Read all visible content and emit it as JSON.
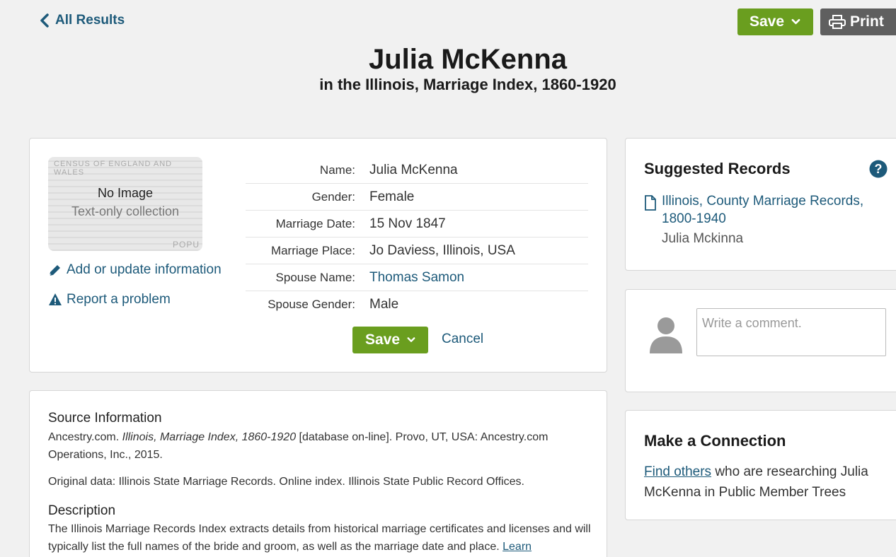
{
  "nav": {
    "back_label": "All Results"
  },
  "toolbar": {
    "save_label": "Save",
    "print_label": "Print"
  },
  "header": {
    "title": "Julia McKenna",
    "subtitle": "in the Illinois, Marriage Index, 1860-1920"
  },
  "record": {
    "image": {
      "ghost_top": "CENSUS OF ENGLAND AND WALES",
      "ghost_bottom": "POPU",
      "no_image": "No Image",
      "note": "Text-only collection"
    },
    "add_update_label": "Add or update information",
    "report_label": "Report a problem",
    "fields": [
      {
        "label": "Name:",
        "value": "Julia McKenna"
      },
      {
        "label": "Gender:",
        "value": "Female"
      },
      {
        "label": "Marriage Date:",
        "value": "15 Nov 1847"
      },
      {
        "label": "Marriage Place:",
        "value": "Jo Daviess, Illinois, USA"
      },
      {
        "label": "Spouse Name:",
        "value": "Thomas Samon"
      },
      {
        "label": "Spouse Gender:",
        "value": "Male"
      }
    ],
    "save_label": "Save",
    "cancel_label": "Cancel"
  },
  "source": {
    "heading": "Source Information",
    "citation_prefix": "Ancestry.com. ",
    "citation_title": "Illinois, Marriage Index, 1860-1920",
    "citation_suffix": " [database on-line]. Provo, UT, USA: Ancestry.com Operations, Inc., 2015.",
    "original_data": "Original data: Illinois State Marriage Records. Online index. Illinois State Public Record Offices.",
    "description_heading": "Description",
    "description_text": "The Illinois Marriage Records Index extracts details from historical marriage certificates and licenses and will typically list the full names of the bride and groom, as well as the marriage date and place. ",
    "learn_link": "Learn"
  },
  "suggested": {
    "title": "Suggested Records",
    "record_title": "Illinois, County Marriage Records, 1800-1940",
    "record_name": "Julia Mckinna"
  },
  "comment": {
    "placeholder": "Write a comment."
  },
  "connection": {
    "title": "Make a Connection",
    "link_text": "Find others",
    "rest_text": " who are researching Julia McKenna in Public Member Trees"
  },
  "colors": {
    "green": "#6a9e1f",
    "print_gray": "#5f5f5f",
    "link_blue": "#1d5a7a",
    "help_blue": "#1d5a7a"
  }
}
